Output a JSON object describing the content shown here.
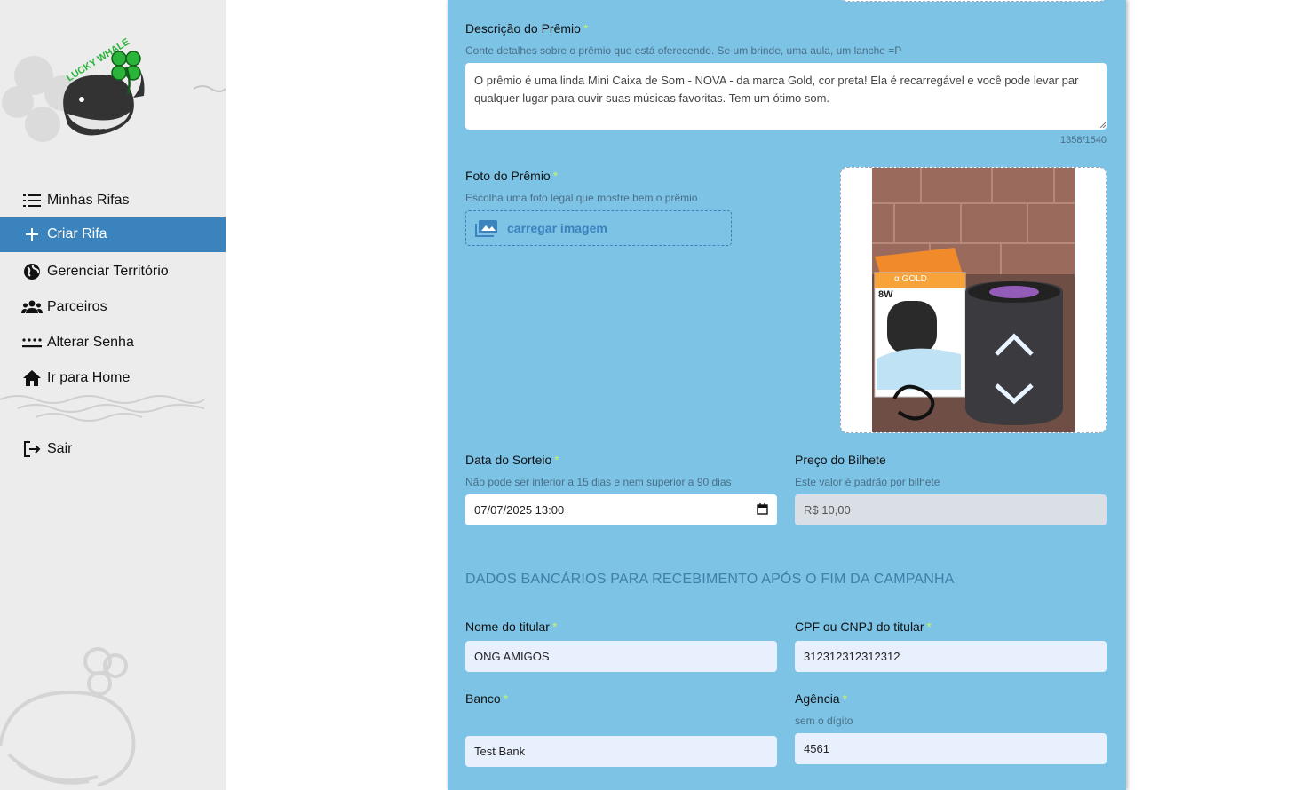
{
  "brand": {
    "logo_text": "LUCKY WHALE"
  },
  "sidebar": {
    "items": [
      {
        "label": "Minhas Rifas",
        "icon": "list-icon",
        "active": false
      },
      {
        "label": "Criar Rifa",
        "icon": "plus-icon",
        "active": true
      },
      {
        "label": "Gerenciar Território",
        "icon": "globe-icon",
        "active": false
      },
      {
        "label": "Parceiros",
        "icon": "people-icon",
        "active": false
      },
      {
        "label": "Alterar Senha",
        "icon": "password-icon",
        "active": false
      },
      {
        "label": "Ir para Home",
        "icon": "home-icon",
        "active": false
      }
    ],
    "logout": {
      "label": "Sair",
      "icon": "logout-icon"
    }
  },
  "form": {
    "description": {
      "label": "Descrição do Prêmio",
      "hint": "Conte detalhes sobre o prêmio que está oferecendo. Se um brinde, uma aula, um lanche =P",
      "value": "O prêmio é uma linda Mini Caixa de Som - NOVA - da marca Gold, cor preta! Ela é recarregável e você pode levar par qualquer lugar para ouvir suas músicas favoritas. Tem um ótimo som.",
      "counter": "1358/1540"
    },
    "photo": {
      "label": "Foto do Prêmio",
      "hint": "Escolha uma foto legal que mostre bem o prêmio",
      "upload_label": "carregar imagem",
      "preview_brand": "α GOLD",
      "preview_model": "8W"
    },
    "draw_date": {
      "label": "Data do Sorteio",
      "hint": "Não pode ser inferior a 15 dias e nem superior a 90 dias",
      "value": "07/07/2025 13:00"
    },
    "ticket_price": {
      "label": "Preço do Bilhete",
      "hint": "Este valor é padrão por bilhete",
      "value": "R$ 10,00"
    },
    "bank_section_title": "DADOS BANCÁRIOS PARA RECEBIMENTO APÓS O FIM DA CAMPANHA",
    "holder_name": {
      "label": "Nome do titular",
      "value": "ONG AMIGOS"
    },
    "holder_doc": {
      "label": "CPF ou CNPJ do titular",
      "value": "312312312312312"
    },
    "bank": {
      "label": "Banco",
      "value": "Test Bank"
    },
    "agency": {
      "label": "Agência",
      "hint": "sem o dígito",
      "value": "4561"
    },
    "required_mark": "*"
  },
  "colors": {
    "sidebar_bg": "#ececec",
    "active_item": "#3b83bd",
    "panel_bg": "#7cc3e6",
    "required": "#c6f26a",
    "section_title": "#3f7fa8"
  }
}
